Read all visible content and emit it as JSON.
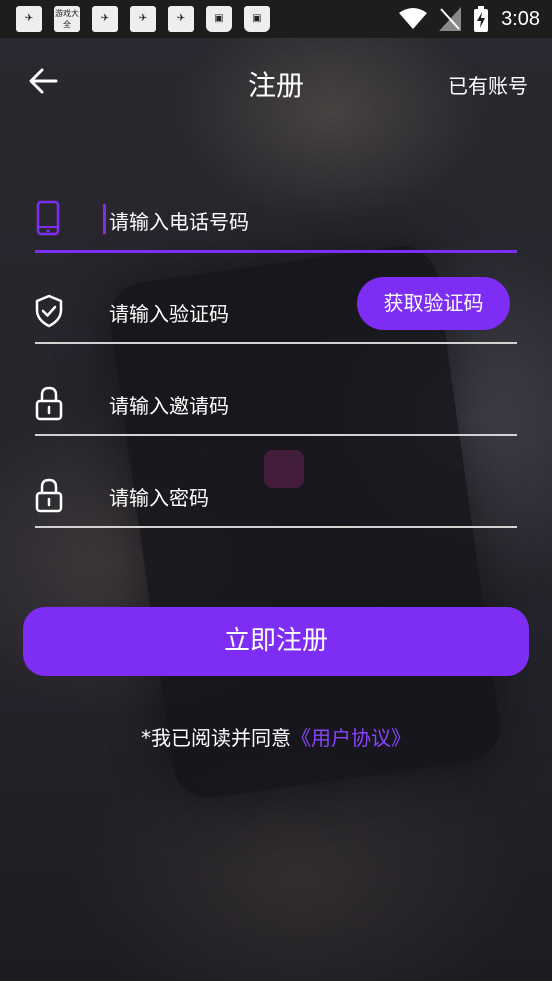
{
  "statusbar": {
    "app_icons": [
      "game-app-icon",
      "youxi-daquan-icon",
      "game-app-icon",
      "game-app-icon",
      "game-app-icon",
      "shopping-bag-icon",
      "shopping-bag-icon"
    ],
    "youxi_label": "游戏大全",
    "time": "3:08"
  },
  "header": {
    "title": "注册",
    "login_link": "已有账号"
  },
  "form": {
    "phone_placeholder": "请输入电话号码",
    "code_placeholder": "请输入验证码",
    "get_code_button": "获取验证码",
    "invite_placeholder": "请输入邀请码",
    "password_placeholder": "请输入密码"
  },
  "submit_label": "立即注册",
  "agreement": {
    "text": "*我已阅读并同意",
    "link": "《用户协议》"
  },
  "colors": {
    "accent": "#7e2df5",
    "link": "#8a43ff"
  }
}
